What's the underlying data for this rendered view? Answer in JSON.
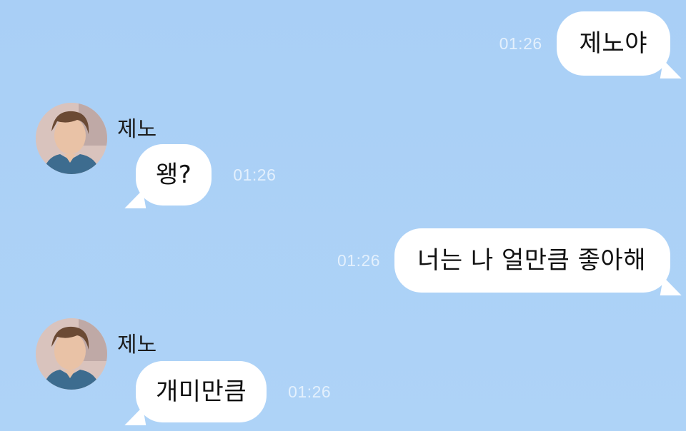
{
  "colors": {
    "background": "#abd1f6",
    "bubble": "#ffffff",
    "timestamp": "#e3f0fd"
  },
  "messages": [
    {
      "direction": "out",
      "text": "제노야",
      "time": "01:26"
    },
    {
      "direction": "in",
      "sender": "제노",
      "avatar": "profile-photo",
      "text": "왱?",
      "time": "01:26"
    },
    {
      "direction": "out",
      "text": "너는 나 얼만큼 좋아해",
      "time": "01:26"
    },
    {
      "direction": "in",
      "sender": "제노",
      "avatar": "profile-photo",
      "text": "개미만큼",
      "time": "01:26"
    }
  ]
}
